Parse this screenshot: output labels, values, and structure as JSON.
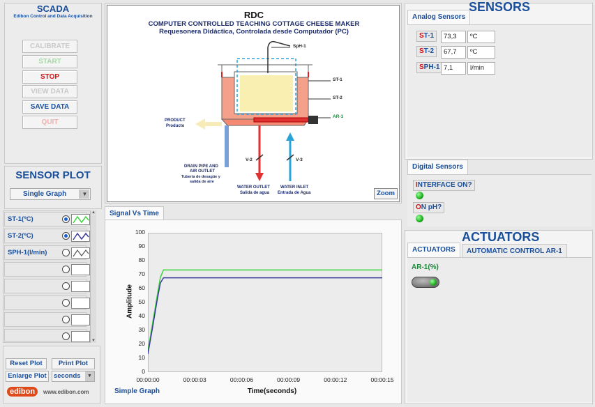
{
  "scada": {
    "title": "SCADA",
    "subtitle": "Edibon Control and Data Acquisition"
  },
  "controls": {
    "calibrate": "CALIBRATE",
    "start": "START",
    "stop": "STOP",
    "view_data": "VIEW DATA",
    "save_data": "SAVE DATA",
    "quit": "QUIT"
  },
  "sensor_plot": {
    "title": "SENSOR PLOT",
    "mode": "Single Graph",
    "channels": [
      {
        "label": "ST-1(ºC)",
        "selected": true
      },
      {
        "label": "ST-2(ºC)",
        "selected": true
      },
      {
        "label": "SPH-1(l/min)",
        "selected": false
      }
    ],
    "reset_plot": "Reset Plot",
    "print_plot": "Print Plot",
    "enlarge_plot": "Enlarge Plot",
    "time_unit": "seconds"
  },
  "logo": {
    "brand": "edibon",
    "url": "www.edibon.com"
  },
  "diagram": {
    "title": "RDC",
    "subtitle1": "COMPUTER CONTROLLED TEACHING COTTAGE CHEESE MAKER",
    "subtitle2": "Requesonera Didáctica, Controlada desde Computador (PC)",
    "sph1": "SpH-1",
    "st1": "ST-1",
    "st2": "ST-2",
    "ar1": "AR-1",
    "product": "PRODUCT",
    "product_es": "Producto",
    "drain1": "DRAIN PIPE AND",
    "drain2": "AIR OUTLET",
    "drain_es1": "Tubería de desagüe y",
    "drain_es2": "salida de aire",
    "v2": "V-2",
    "v3": "V-3",
    "water_out": "WATER OUTLET",
    "water_out_es": "Salida de agua",
    "water_in": "WATER INLET",
    "water_in_es": "Entrada de Agua",
    "zoom": "Zoom"
  },
  "graph": {
    "tab": "Signal Vs Time",
    "ylabel": "Amplitude",
    "xlabel": "Time(seconds)",
    "footer": "Simple Graph"
  },
  "chart_data": {
    "type": "line",
    "xlabel": "Time(seconds)",
    "ylabel": "Amplitude",
    "xlim": [
      0,
      15
    ],
    "ylim": [
      0,
      100
    ],
    "xticks": [
      "00:00:00",
      "00:00:03",
      "00:00:06",
      "00:00:09",
      "00:00:12",
      "00:00:15"
    ],
    "yticks": [
      0,
      10,
      20,
      30,
      40,
      50,
      60,
      70,
      80,
      90,
      100
    ],
    "series": [
      {
        "color": "#3ed43e",
        "x": [
          0,
          0.3,
          0.6,
          0.8,
          1,
          15
        ],
        "y": [
          15,
          35,
          55,
          68,
          73.3,
          73.3
        ]
      },
      {
        "color": "#3a3a9a",
        "x": [
          0,
          0.3,
          0.6,
          0.8,
          1,
          15
        ],
        "y": [
          13,
          32,
          52,
          64,
          67.7,
          67.7
        ]
      }
    ]
  },
  "sensors": {
    "title": "SENSORS",
    "tab": "Analog Sensors",
    "rows": [
      {
        "tag_first": "S",
        "tag_rest": "T-1",
        "value": "73,3",
        "unit": "ºC"
      },
      {
        "tag_first": "S",
        "tag_rest": "T-2",
        "value": "67,7",
        "unit": "ºC"
      },
      {
        "tag_first": "S",
        "tag_rest": "PH-1",
        "value": "7,1",
        "unit": "l/min"
      }
    ],
    "digital_tab": "Digital Sensors",
    "digital": [
      {
        "tag_first": "I",
        "tag_rest": "NTERFACE ON?"
      },
      {
        "tag_first": "O",
        "tag_rest": "N pH?"
      }
    ]
  },
  "actuators": {
    "title": "ACTUATORS",
    "tab1": "ACTUATORS",
    "tab2": "AUTOMATIC CONTROL AR-1",
    "ar1": "AR-1(%)"
  }
}
